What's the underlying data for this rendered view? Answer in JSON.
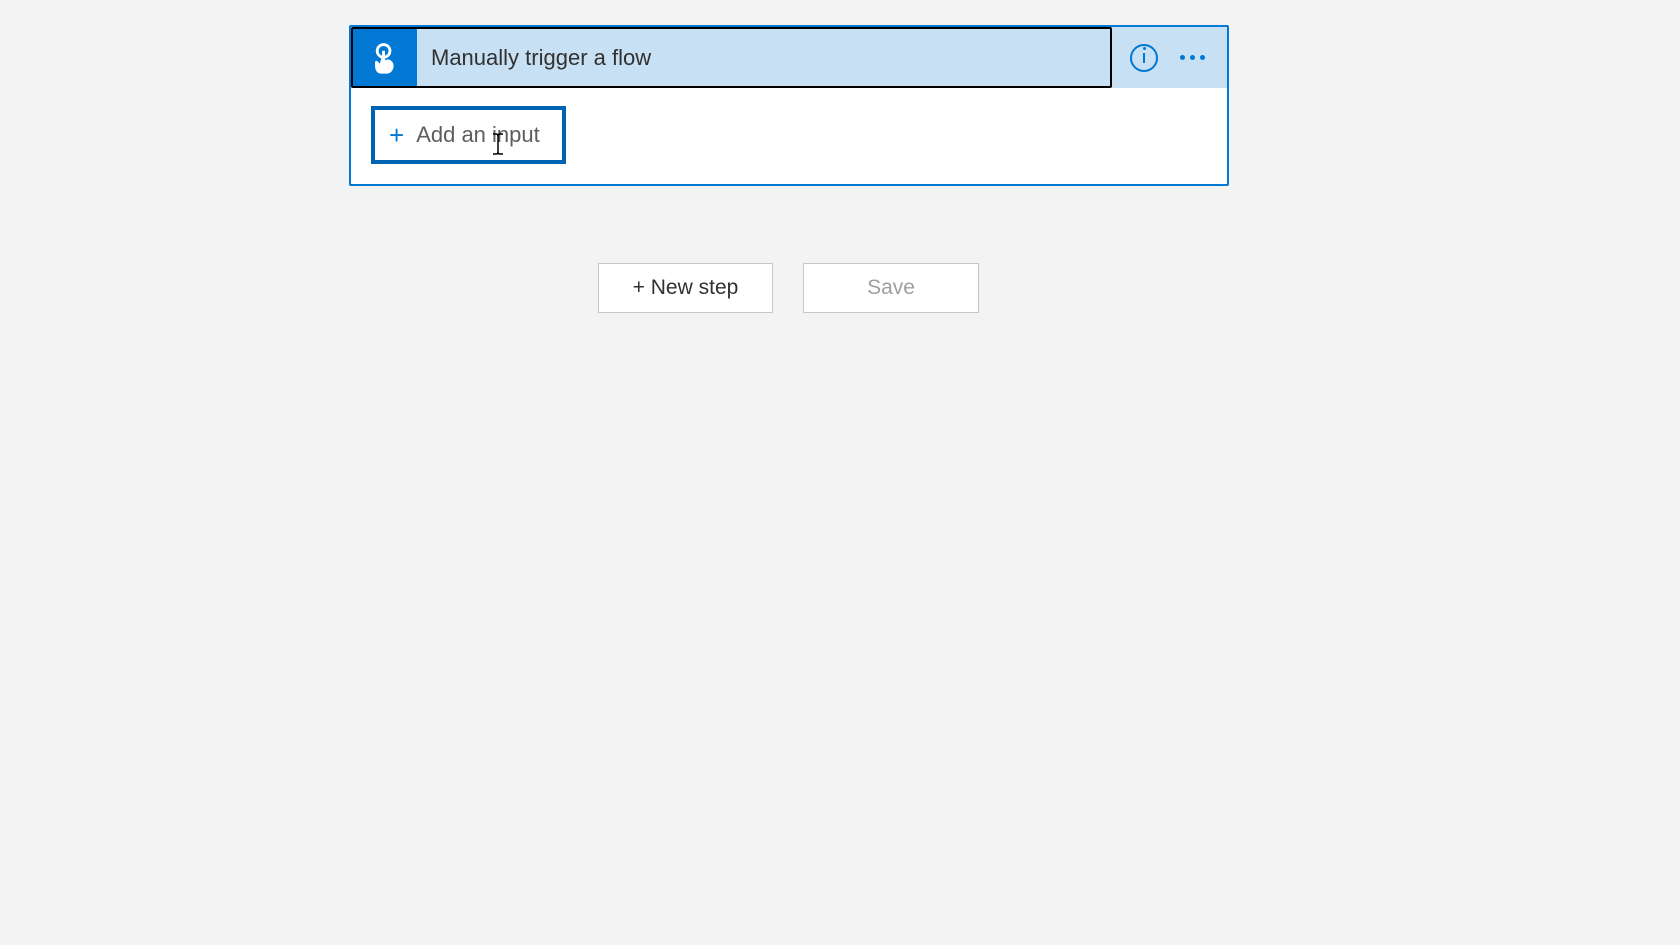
{
  "trigger": {
    "title": "Manually trigger a flow",
    "icon_name": "touch-icon",
    "add_input_label": "Add an input"
  },
  "actions": {
    "new_step_label": "+ New step",
    "save_label": "Save"
  }
}
